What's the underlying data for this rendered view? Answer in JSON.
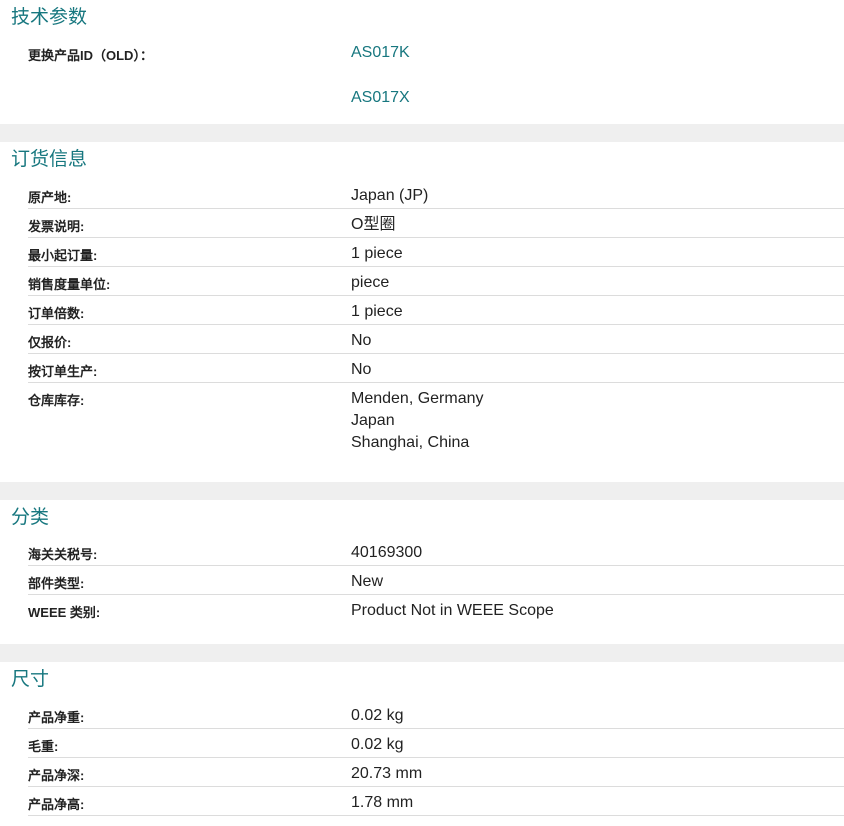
{
  "tech_params": {
    "title": "技术参数",
    "replacement_label": "更换产品ID（OLD）：",
    "replacement_links": [
      "AS017K",
      "AS017X"
    ]
  },
  "ordering": {
    "title": "订货信息",
    "rows": [
      {
        "label": "原产地:",
        "value": "Japan (JP)"
      },
      {
        "label": "发票说明:",
        "value": "O型圈"
      },
      {
        "label": "最小起订量:",
        "value": "1 piece"
      },
      {
        "label": "销售度量单位:",
        "value": "piece"
      },
      {
        "label": "订单倍数:",
        "value": "1 piece"
      },
      {
        "label": "仅报价:",
        "value": "No"
      },
      {
        "label": "按订单生产:",
        "value": "No"
      }
    ],
    "stock_label": "仓库库存:",
    "stock_locations": [
      "Menden, Germany",
      "Japan",
      "Shanghai, China"
    ]
  },
  "classification": {
    "title": "分类",
    "rows": [
      {
        "label": "海关关税号:",
        "value": "40169300"
      },
      {
        "label": "部件类型:",
        "value": "New"
      },
      {
        "label": "WEEE 类别:",
        "value": "Product Not in WEEE Scope"
      }
    ]
  },
  "dimensions": {
    "title": "尺寸",
    "rows": [
      {
        "label": "产品净重:",
        "value": "0.02 kg"
      },
      {
        "label": "毛重:",
        "value": "0.02 kg"
      },
      {
        "label": "产品净深:",
        "value": "20.73 mm"
      },
      {
        "label": "产品净高:",
        "value": "1.78 mm"
      }
    ]
  },
  "colors": {
    "accent": "#17777f",
    "divider": "#dcdcdc",
    "gap": "#efefef"
  }
}
